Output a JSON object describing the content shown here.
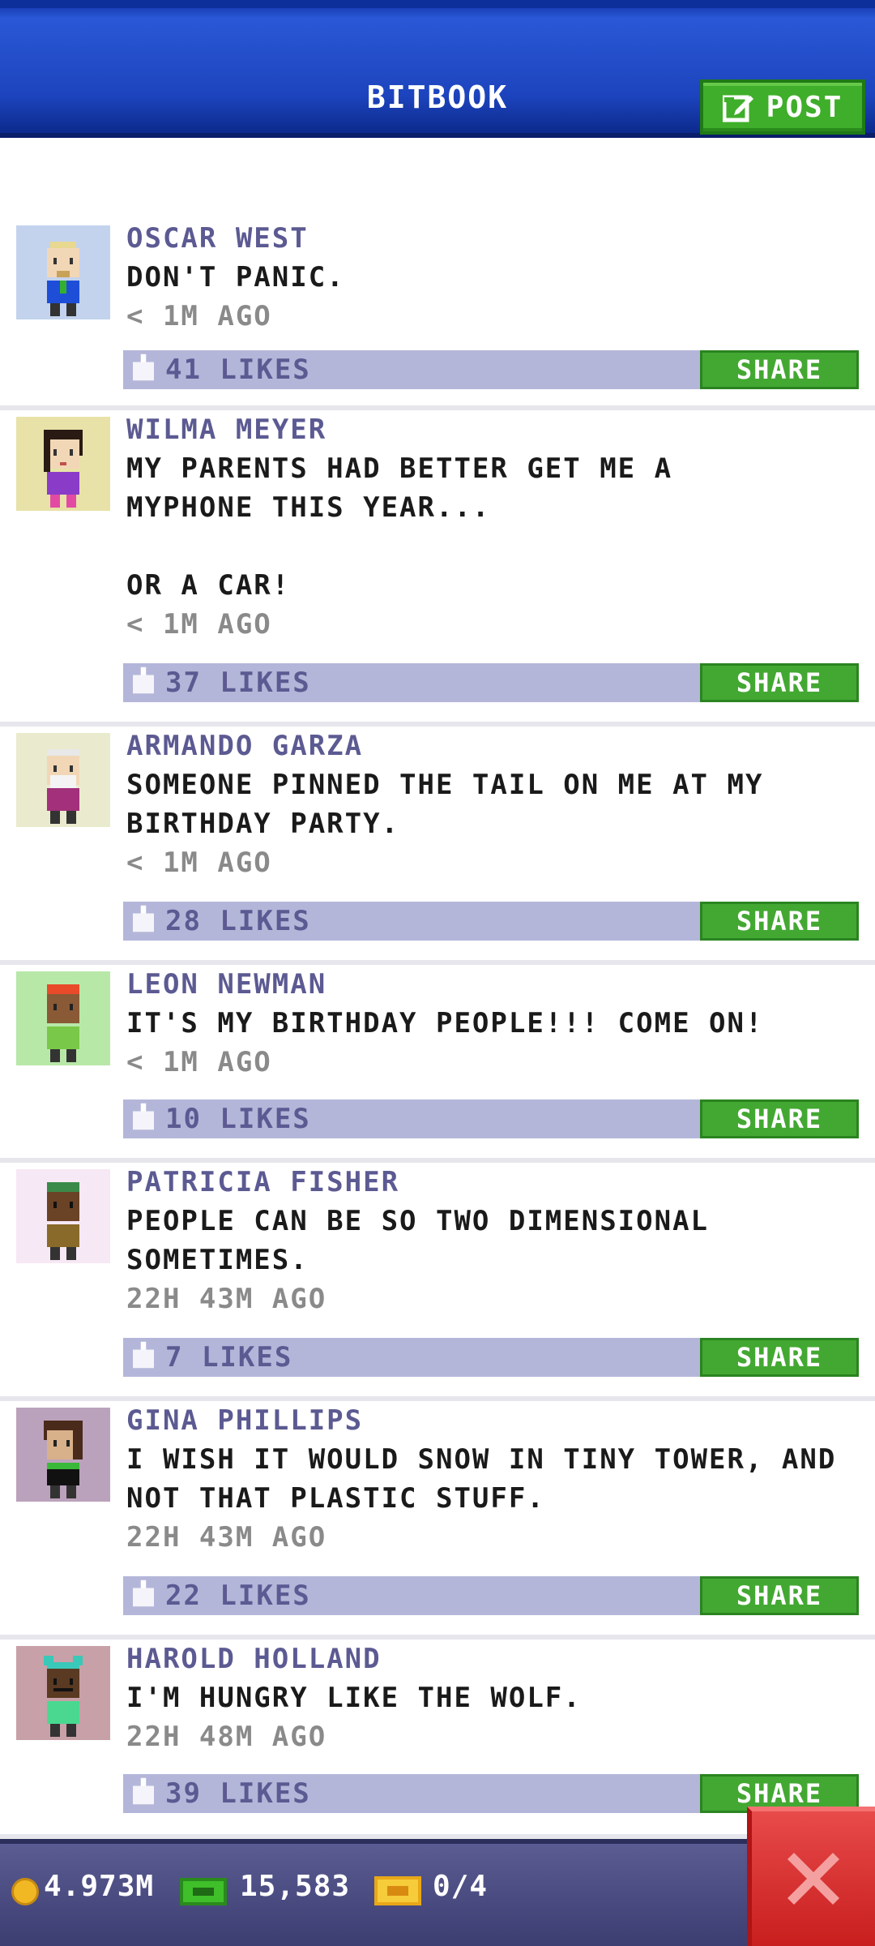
{
  "header": {
    "title": "BITBOOK",
    "post_label": "POST"
  },
  "feed": {
    "share_label": "SHARE",
    "posts": [
      {
        "name": "OSCAR WEST",
        "message": "DON'T PANIC.",
        "time": "< 1M AGO",
        "likes": "41 LIKES"
      },
      {
        "name": "WILMA MEYER",
        "message": "MY PARENTS HAD BETTER GET ME A\nMYPHONE THIS YEAR...\n\nOR A CAR!",
        "time": "< 1M AGO",
        "likes": "37 LIKES"
      },
      {
        "name": "ARMANDO GARZA",
        "message": "SOMEONE PINNED THE TAIL ON ME AT MY\nBIRTHDAY PARTY.",
        "time": "< 1M AGO",
        "likes": "28 LIKES"
      },
      {
        "name": "LEON NEWMAN",
        "message": "IT'S MY BIRTHDAY PEOPLE!!! COME ON!",
        "time": "< 1M AGO",
        "likes": "10 LIKES"
      },
      {
        "name": "PATRICIA FISHER",
        "message": "PEOPLE CAN BE SO TWO DIMENSIONAL\nSOMETIMES.",
        "time": "22H 43M AGO",
        "likes": "7 LIKES"
      },
      {
        "name": "GINA PHILLIPS",
        "message": "I WISH IT WOULD SNOW IN TINY TOWER, AND\nNOT THAT PLASTIC STUFF.",
        "time": "22H 43M AGO",
        "likes": "22 LIKES"
      },
      {
        "name": "HAROLD HOLLAND",
        "message": "I'M HUNGRY LIKE THE WOLF.",
        "time": "22H 48M AGO",
        "likes": "39 LIKES"
      }
    ]
  },
  "footer": {
    "coins": "4.973M",
    "bux": "15,583",
    "tickets": "0/4"
  },
  "colors": {
    "header_blue": "#1d44be",
    "share_green": "#43a832",
    "likes_bar": "#b4b6d9",
    "name_purple": "#5c5a92",
    "close_red": "#d82c2c"
  }
}
